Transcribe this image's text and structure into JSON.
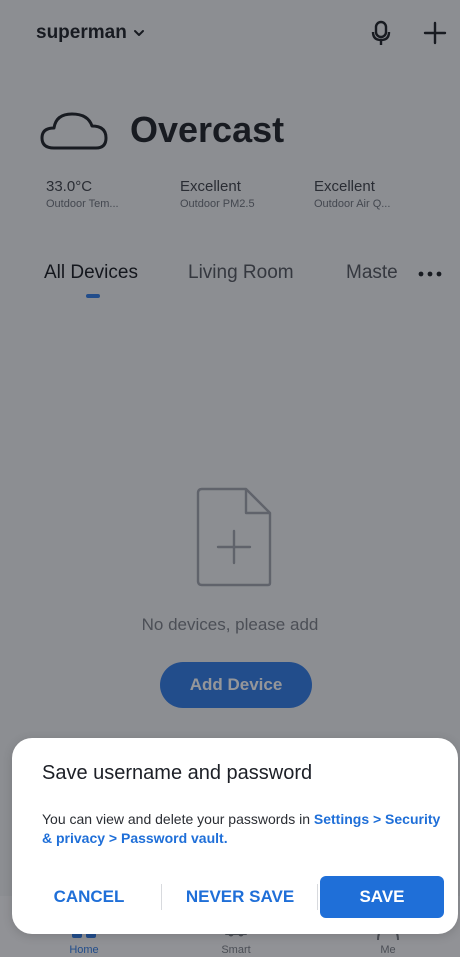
{
  "header": {
    "account_name": "superman",
    "icons": [
      "chevron-down-icon",
      "microphone-icon",
      "plus-icon"
    ]
  },
  "weather": {
    "condition": "Overcast",
    "icon": "cloud-icon",
    "stats": [
      {
        "value": "33.0°C",
        "label": "Outdoor Tem..."
      },
      {
        "value": "Excellent",
        "label": "Outdoor PM2.5"
      },
      {
        "value": "Excellent",
        "label": "Outdoor Air Q..."
      }
    ]
  },
  "tabs": [
    {
      "label": "All Devices",
      "active": true
    },
    {
      "label": "Living Room",
      "active": false
    },
    {
      "label": "Maste",
      "active": false
    }
  ],
  "empty_state": {
    "message": "No devices, please add",
    "button": "Add Device",
    "icon": "add-file-icon"
  },
  "bottom_nav": [
    {
      "label": "Home",
      "icon": "home-icon",
      "active": true
    },
    {
      "label": "Smart",
      "icon": "smart-icon",
      "active": false
    },
    {
      "label": "Me",
      "icon": "profile-icon",
      "active": false
    }
  ],
  "dialog": {
    "title": "Save username and password",
    "message_prefix": "You can view and delete your passwords in ",
    "message_link": "Settings > Security & privacy > Password vault.",
    "cancel": "CANCEL",
    "never_save": "NEVER SAVE",
    "save": "SAVE"
  },
  "colors": {
    "accent": "#1f6fd8",
    "scrim": "rgba(20,22,28,0.45)",
    "background": "#eef0f3"
  }
}
